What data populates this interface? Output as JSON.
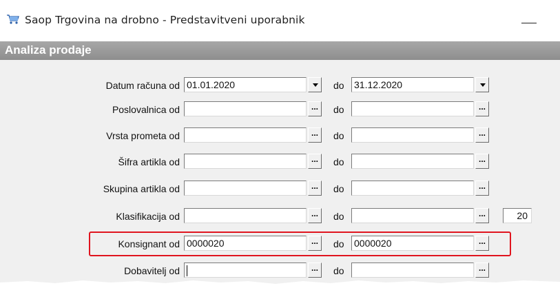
{
  "window": {
    "title": "Saop Trgovina na drobno - Predstavitveni uporabnik",
    "icon": "shopping-cart-icon"
  },
  "section": {
    "title": "Analiza prodaje"
  },
  "form": {
    "separator_label": "do",
    "lookup_button_label": "...",
    "rows": [
      {
        "label": "Datum računa od",
        "from": "01.01.2020",
        "to": "31.12.2020",
        "control": "dropdown"
      },
      {
        "label": "Poslovalnica od",
        "from": "",
        "to": "",
        "control": "lookup"
      },
      {
        "label": "Vrsta prometa od",
        "from": "",
        "to": "",
        "control": "lookup"
      },
      {
        "label": "Šifra artikla od",
        "from": "",
        "to": "",
        "control": "lookup"
      },
      {
        "label": "Skupina artikla od",
        "from": "",
        "to": "",
        "control": "lookup"
      },
      {
        "label": "Klasifikacija od",
        "from": "",
        "to": "",
        "control": "lookup",
        "extra_value": "20"
      },
      {
        "label": "Konsignant od",
        "from": "0000020",
        "to": "0000020",
        "control": "lookup",
        "highlighted": true
      },
      {
        "label": "Dobavitelj od",
        "from": "",
        "to": "",
        "control": "lookup"
      }
    ]
  },
  "colors": {
    "highlight": "#e0141e",
    "section_header": "#9a9a9a"
  }
}
